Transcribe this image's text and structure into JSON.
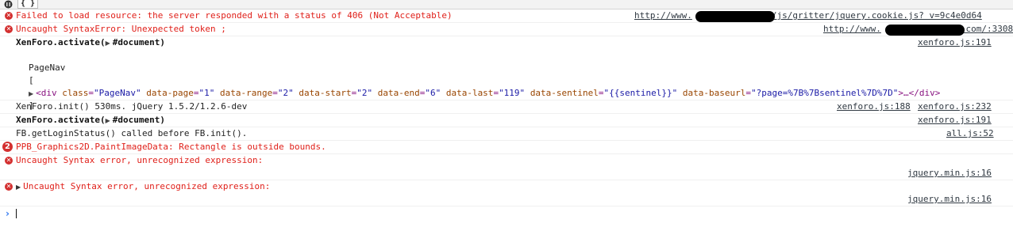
{
  "toolbar": {
    "braces_label": "{ }"
  },
  "messages": {
    "m1": {
      "text": "Failed to load resource: the server responded with a status of 406 (Not Acceptable)",
      "src_prefix": "http://www.",
      "src_suffix": "/js/gritter/jquery.cookie.js? v=9c4e0d64"
    },
    "m2": {
      "text": "Uncaught SyntaxError: Unexpected token ;",
      "src_prefix": "http://www.",
      "src_suffix": ".com/:3308"
    },
    "m3": {
      "head": "XenForo.activate(",
      "arg": "#document",
      "close": ")",
      "src": "xenforo.js:191",
      "line_pagenav": "PageNav",
      "line_open": "[",
      "div_open": "<div",
      "attrs": [
        {
          "name": "class",
          "value": "\"PageNav\""
        },
        {
          "name": "data-page",
          "value": "\"1\""
        },
        {
          "name": "data-range",
          "value": "\"2\""
        },
        {
          "name": "data-start",
          "value": "\"2\""
        },
        {
          "name": "data-end",
          "value": "\"6\""
        },
        {
          "name": "data-last",
          "value": "\"119\""
        },
        {
          "name": "data-sentinel",
          "value": "\"{{sentinel}}\""
        },
        {
          "name": "data-baseurl",
          "value": "\"?page=%7B%7Bsentinel%7D%7D\""
        }
      ],
      "div_close": ">…</div>",
      "line_close": "]"
    },
    "m4": {
      "text": "XenForo.init() 530ms. jQuery 1.5.2/1.2.6-dev",
      "src1": "xenforo.js:188",
      "src2": "xenforo.js:232"
    },
    "m5": {
      "head": "XenForo.activate(",
      "arg": "#document",
      "close": ")",
      "src": "xenforo.js:191"
    },
    "m6": {
      "text": "FB.getLoginStatus() called before FB.init().",
      "src": "all.js:52"
    },
    "m7": {
      "badge": "2",
      "text": "PPB_Graphics2D.PaintImageData: Rectangle is outside bounds."
    },
    "m8": {
      "text": "Uncaught Syntax error, unrecognized expression:",
      "src": "jquery.min.js:16"
    },
    "m9": {
      "text": "Uncaught Syntax error, unrecognized expression:",
      "src": "jquery.min.js:16"
    }
  },
  "prompt": {
    "symbol": "›"
  },
  "colors": {
    "error": "#e0201a",
    "prompt": "#367cf1",
    "tag": "#881280",
    "attr_name": "#994500",
    "attr_value": "#1a1aa6"
  }
}
